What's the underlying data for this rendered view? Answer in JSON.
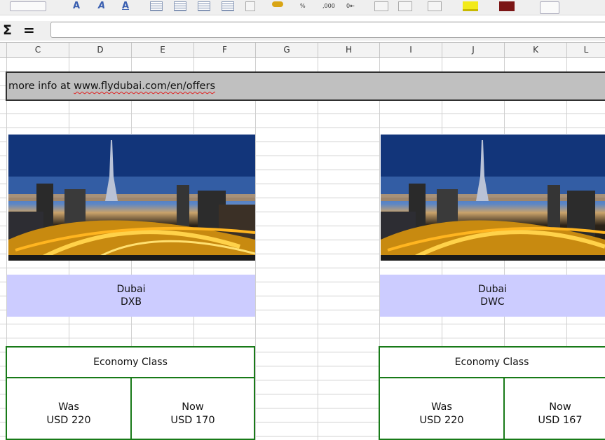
{
  "formula_bar": {
    "sigma": "Σ",
    "equals": "=",
    "value": ""
  },
  "toolbar": {
    "thousands_label": ",000",
    "decimal_label": "0⇤"
  },
  "columns": [
    "C",
    "D",
    "E",
    "F",
    "G",
    "H",
    "I",
    "J",
    "K",
    "L"
  ],
  "info": {
    "prefix": "more info at ",
    "link": "www.flydubai.com/en/offers"
  },
  "offers": [
    {
      "city": "Dubai",
      "code": "DXB",
      "class": "Economy Class",
      "was_label": "Was",
      "was_price": "USD 220",
      "now_label": "Now",
      "now_price": "USD 170"
    },
    {
      "city": "Dubai",
      "code": "DWC",
      "class": "Economy Class",
      "was_label": "Was",
      "was_price": "USD 220",
      "now_label": "Now",
      "now_price": "USD 167"
    }
  ],
  "colors": {
    "city_bg": "#ccccff",
    "border_green": "#187a18",
    "info_bg": "#c0c0c0"
  }
}
